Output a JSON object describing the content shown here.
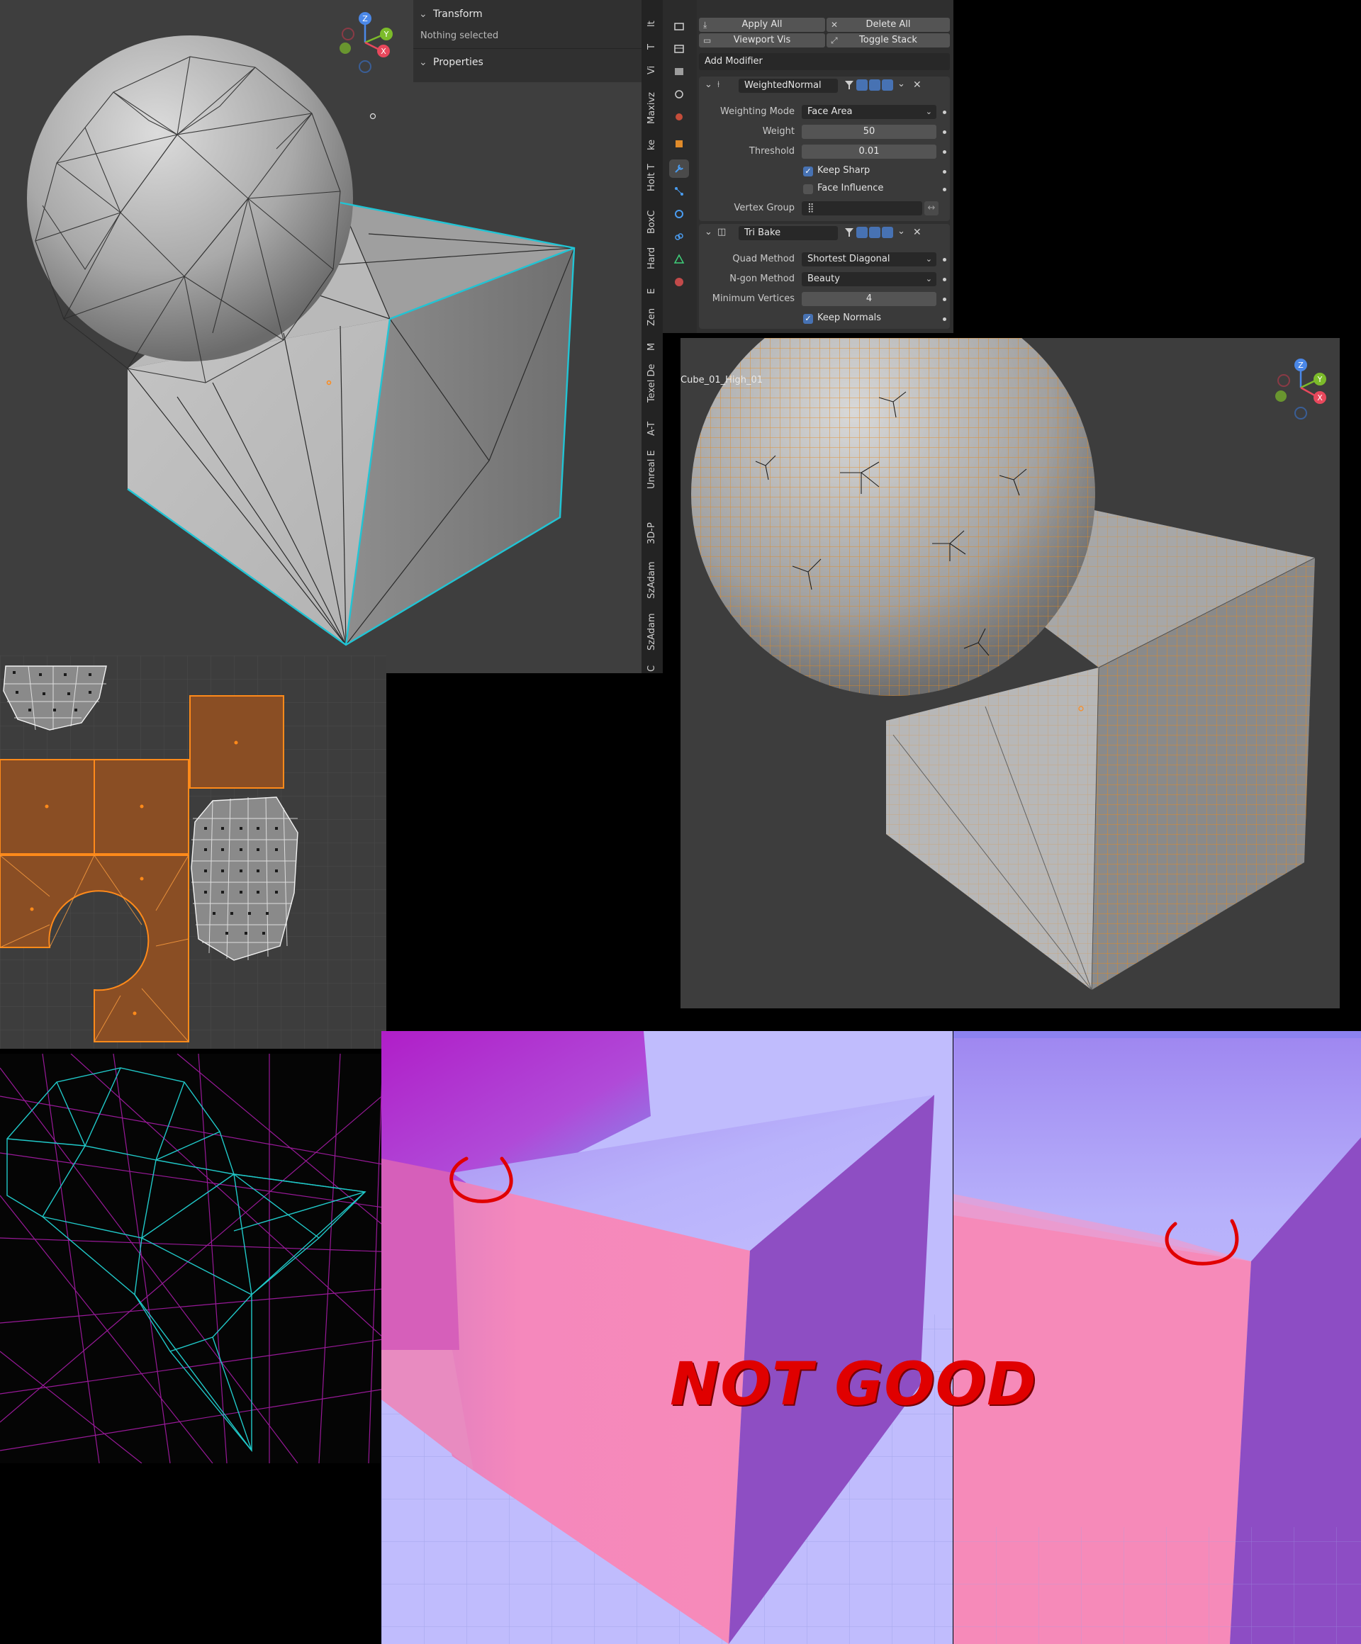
{
  "npanel": {
    "transform_header": "Transform",
    "transform_status": "Nothing selected",
    "properties_header": "Properties"
  },
  "side_tabs": [
    "lt",
    "T",
    "Vi",
    "Maxivz",
    "ke",
    "Holt T",
    "BoxC",
    "Hard",
    "E",
    "Zen",
    "M",
    "Texel De",
    "A-T",
    "Unreal E",
    "3D-P",
    "SzAdam",
    "SzAdam",
    "C"
  ],
  "toolbar": {
    "apply_all": "Apply All",
    "delete_all": "Delete All",
    "viewport_vis": "Viewport Vis",
    "toggle_stack": "Toggle Stack",
    "add_modifier": "Add Modifier"
  },
  "weighted_normal": {
    "name": "WeightedNormal",
    "weighting_mode_label": "Weighting Mode",
    "weighting_mode_value": "Face Area",
    "weight_label": "Weight",
    "weight_value": "50",
    "threshold_label": "Threshold",
    "threshold_value": "0.01",
    "keep_sharp_label": "Keep Sharp",
    "keep_sharp_checked": true,
    "face_influence_label": "Face Influence",
    "face_influence_checked": false,
    "vertex_group_label": "Vertex Group",
    "vertex_group_value": ""
  },
  "tri_bake": {
    "name": "Tri Bake",
    "quad_method_label": "Quad Method",
    "quad_method_value": "Shortest Diagonal",
    "ngon_method_label": "N-gon Method",
    "ngon_method_value": "Beauty",
    "min_vertices_label": "Minimum Vertices",
    "min_vertices_value": "4",
    "keep_normals_label": "Keep Normals",
    "keep_normals_checked": true
  },
  "viewport_high": {
    "object_name": "Cube_01_High_01"
  },
  "gizmo": {
    "x": "X",
    "y": "Y",
    "z": "Z"
  },
  "annotation": {
    "text": "NOT GOOD",
    "color": "#e00000"
  },
  "colors": {
    "viewport_bg": "#3d3d3d",
    "selection_edge": "#21c4d4",
    "uv_island": "#8a4e24",
    "uv_select": "#ff8a1a",
    "normal_pink": "#f78bbf",
    "normal_blue": "#b6b1fb",
    "normal_purple": "#8c4fc3"
  },
  "icons": [
    "chevron-down-icon",
    "wrench-icon",
    "close-icon",
    "checkbox-icon",
    "filter-icon",
    "camera-icon",
    "monitor-icon",
    "navigation-gizmo"
  ]
}
